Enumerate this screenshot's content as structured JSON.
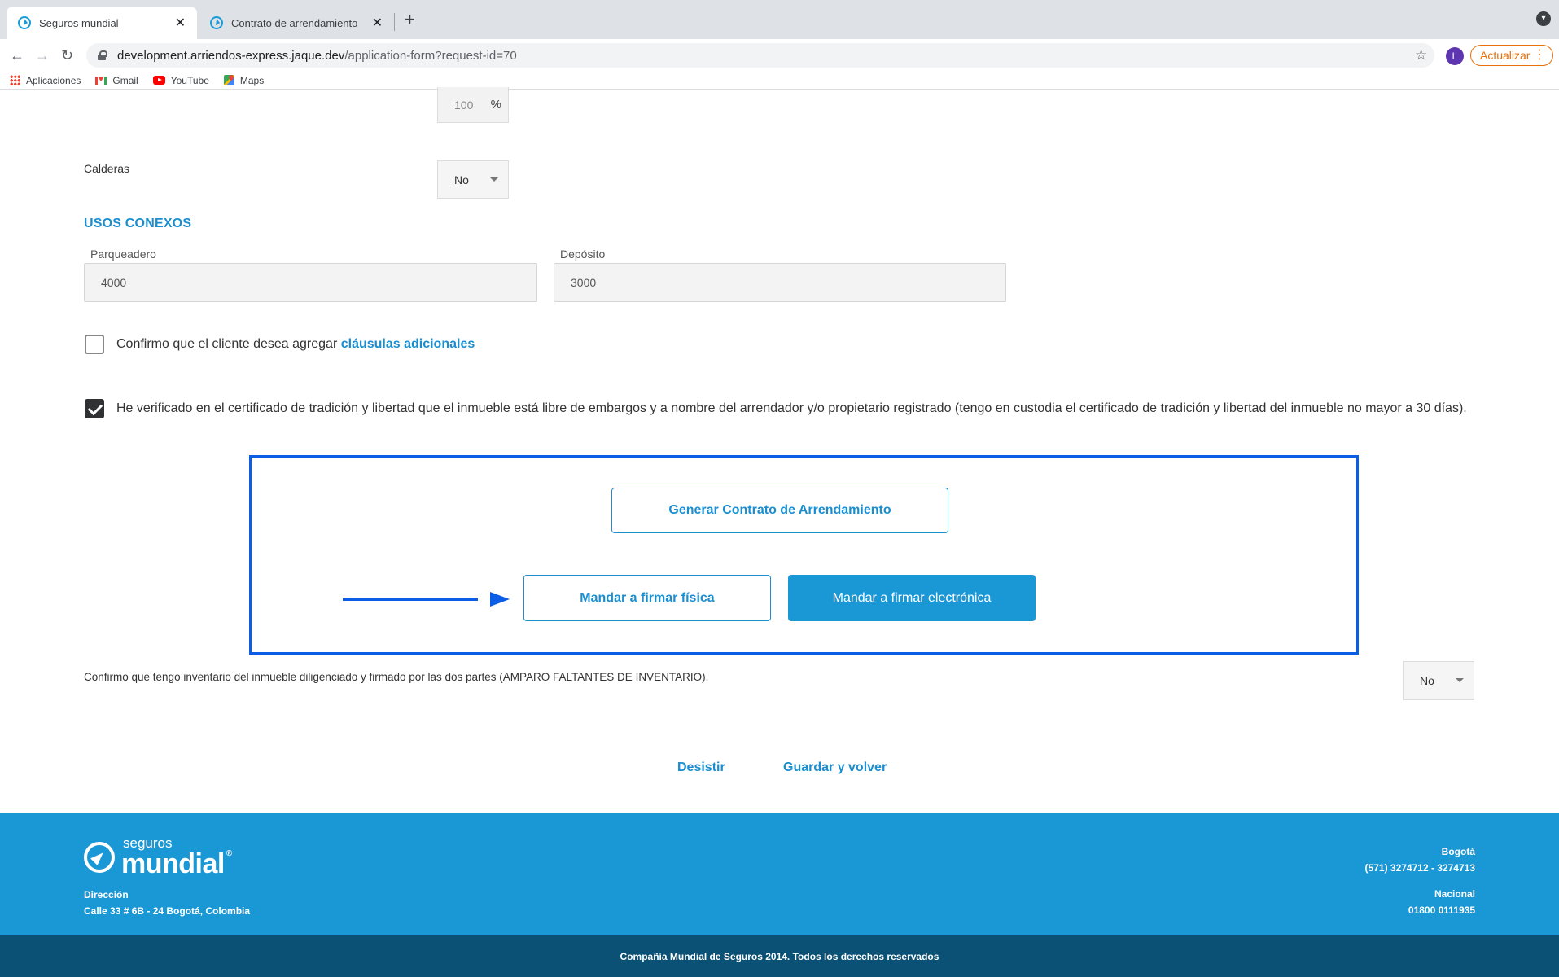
{
  "browser": {
    "tabs": [
      {
        "title": "Seguros mundial",
        "active": true
      },
      {
        "title": "Contrato de arrendamiento",
        "active": false
      }
    ],
    "url_host": "development.arriendos-express.jaque.dev",
    "url_path": "/application-form?request-id=70",
    "profile_initial": "L",
    "update_label": "Actualizar",
    "bookmarks": [
      "Aplicaciones",
      "Gmail",
      "YouTube",
      "Maps"
    ]
  },
  "form": {
    "percent_value": "100",
    "percent_symbol": "%",
    "calderas_label": "Calderas",
    "calderas_value": "No",
    "section_title": "USOS CONEXOS",
    "parqueadero_label": "Parqueadero",
    "parqueadero_value": "4000",
    "deposito_label": "Depósito",
    "deposito_value": "3000",
    "clausulas_text": "Confirmo que el cliente desea agregar ",
    "clausulas_link": "cláusulas adicionales",
    "clausulas_checked": false,
    "certificado_text": "He verificado en el certificado de tradición y libertad que el inmueble está libre de embargos y a nombre del arrendador y/o propietario registrado (tengo en custodia el certificado de tradición y libertad del inmueble no mayor a 30 días).",
    "certificado_checked": true,
    "generar_label": "Generar Contrato de Arrendamiento",
    "firma_fisica_label": "Mandar a firmar física",
    "firma_electronica_label": "Mandar a firmar electrónica",
    "inventario_text": "Confirmo que tengo inventario del inmueble diligenciado y firmado por las dos partes (AMPARO FALTANTES DE INVENTARIO).",
    "inventario_value": "No",
    "desistir_label": "Desistir",
    "guardar_label": "Guardar y volver"
  },
  "footer": {
    "logo_small": "seguros",
    "logo_big": "mundial",
    "logo_reg": "®",
    "direccion_label": "Dirección",
    "direccion_value": "Calle 33 # 6B - 24 Bogotá, Colombia",
    "bogota_label": "Bogotá",
    "bogota_phone": "(571) 3274712 - 3274713",
    "nacional_label": "Nacional",
    "nacional_phone": "01800 0111935",
    "copyright": "Compañía Mundial de Seguros 2014. Todos los derechos reservados"
  },
  "colors": {
    "accent": "#1a8ecf",
    "footer_bg": "#1a98d5",
    "copyright_bg": "#0b5075",
    "highlight": "#0b5de5"
  }
}
